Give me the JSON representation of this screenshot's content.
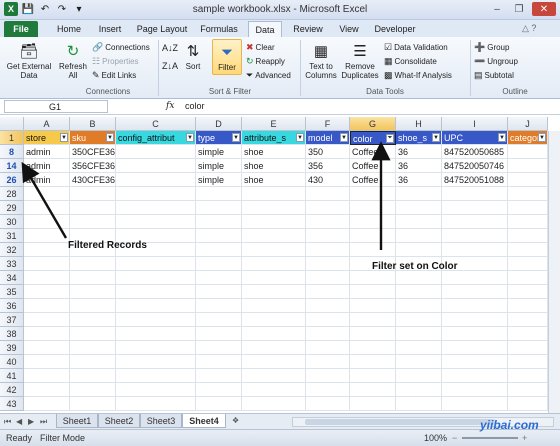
{
  "window": {
    "title": "sample workbook.xlsx - Microsoft Excel"
  },
  "tabs": [
    "File",
    "Home",
    "Insert",
    "Page Layout",
    "Formulas",
    "Data",
    "Review",
    "View",
    "Developer"
  ],
  "ribbon": {
    "get_external_data": "Get External Data",
    "refresh_all": "Refresh All",
    "connections": "Connections",
    "properties": "Properties",
    "edit_links": "Edit Links",
    "connections_group": "Connections",
    "sort": "Sort",
    "filter": "Filter",
    "clear": "Clear",
    "reapply": "Reapply",
    "advanced": "Advanced",
    "sort_filter_group": "Sort & Filter",
    "text_to_columns": "Text to Columns",
    "remove_duplicates": "Remove Duplicates",
    "data_validation": "Data Validation",
    "consolidate": "Consolidate",
    "what_if": "What-If Analysis",
    "data_tools_group": "Data Tools",
    "group": "Group",
    "ungroup": "Ungroup",
    "subtotal": "Subtotal",
    "outline_group": "Outline"
  },
  "formula_bar": {
    "name_box": "G1",
    "fx": "fx",
    "value": "color"
  },
  "columns": [
    "A",
    "B",
    "C",
    "D",
    "E",
    "F",
    "G",
    "H",
    "I",
    "J"
  ],
  "headers": [
    "store",
    "sku",
    "config_attribut",
    "type",
    "attribute_s",
    "model",
    "color",
    "shoe_s",
    "UPC",
    "categor"
  ],
  "header_colors": [
    "#f7c94a",
    "#e07b27",
    "#38d8e0",
    "#3858c8",
    "#38d8e0",
    "#3858c8",
    "#3858c8",
    "#3858c8",
    "#3858c8",
    "#e07b27"
  ],
  "rows": [
    {
      "num": "8",
      "cells": [
        "admin",
        "350CFE36LTR13FAL",
        "",
        "simple",
        "shoe",
        "350",
        "Coffee",
        "36",
        "847520050685",
        ""
      ]
    },
    {
      "num": "14",
      "cells": [
        "admin",
        "356CFE36LTR13FAL",
        "",
        "simple",
        "shoe",
        "356",
        "Coffee",
        "36",
        "847520050746",
        ""
      ]
    },
    {
      "num": "26",
      "cells": [
        "admin",
        "430CFE36LTR13FAL",
        "",
        "simple",
        "shoe",
        "430",
        "Coffee",
        "36",
        "847520051088",
        ""
      ]
    }
  ],
  "empty_rows": [
    "28",
    "29",
    "30",
    "31",
    "32",
    "33",
    "34",
    "35",
    "36",
    "37",
    "38",
    "39",
    "40",
    "41",
    "42",
    "43",
    "44",
    "45",
    "46",
    "47"
  ],
  "annotations": {
    "filtered_records": "Filtered Records",
    "filter_on_color": "Filter set on Color"
  },
  "sheets": [
    "Sheet1",
    "Sheet2",
    "Sheet3",
    "Sheet4"
  ],
  "active_sheet": "Sheet4",
  "status": {
    "ready": "Ready",
    "mode": "Filter Mode",
    "zoom": "100%"
  },
  "watermark": "yiibai.com"
}
